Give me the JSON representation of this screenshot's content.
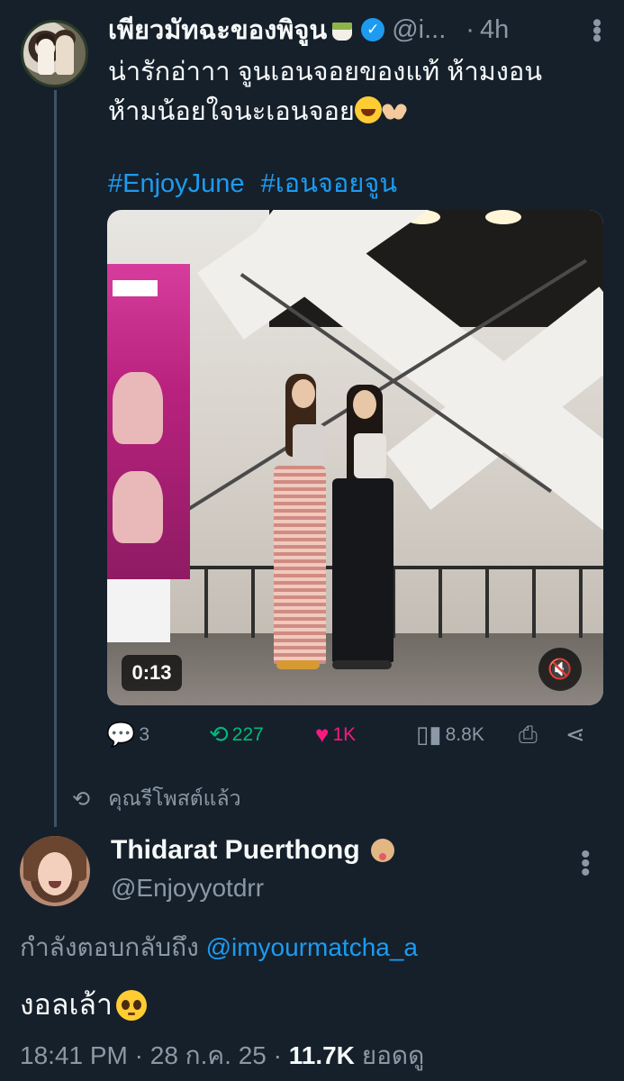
{
  "tweet": {
    "author_name": "เพียวมัทฉะของพิจูน",
    "handle": "@i...",
    "time": "4h",
    "text_lines": [
      "น่ารักอ่าาา จูนเอนจอยของแท้ ห้ามงอน",
      "ห้ามน้อยใจนะเอนจอย"
    ],
    "hashtags": [
      "#EnjoyJune",
      "#เอนจอยจูน"
    ],
    "video": {
      "duration": "0:13"
    },
    "stats": {
      "replies": "3",
      "retweets": "227",
      "likes": "1K",
      "views": "8.8K"
    }
  },
  "repost_label": "คุณรีโพสต์แล้ว",
  "reply": {
    "author_name": "Thidarat Puerthong",
    "handle": "@Enjoyyotdrr",
    "replying_prefix": "กำลังตอบกลับถึง",
    "replying_to": "@imyourmatcha_a",
    "text": "งอลเล้า",
    "time": "18:41 PM",
    "date": "28 ก.ค. 25",
    "views": "11.7K",
    "views_label": "ยอดดู"
  },
  "icons": {
    "reply": "comment-icon",
    "retweet": "retweet-icon",
    "like": "heart-icon",
    "views": "bar-chart-icon",
    "bookmark": "bookmark-icon",
    "share": "share-icon",
    "mute": "muted-speaker-icon"
  },
  "colors": {
    "background": "#15202b",
    "accent": "#1d9bf0",
    "retweet": "#00ba7c",
    "like": "#f91880",
    "muted_text": "#8b98a5"
  }
}
